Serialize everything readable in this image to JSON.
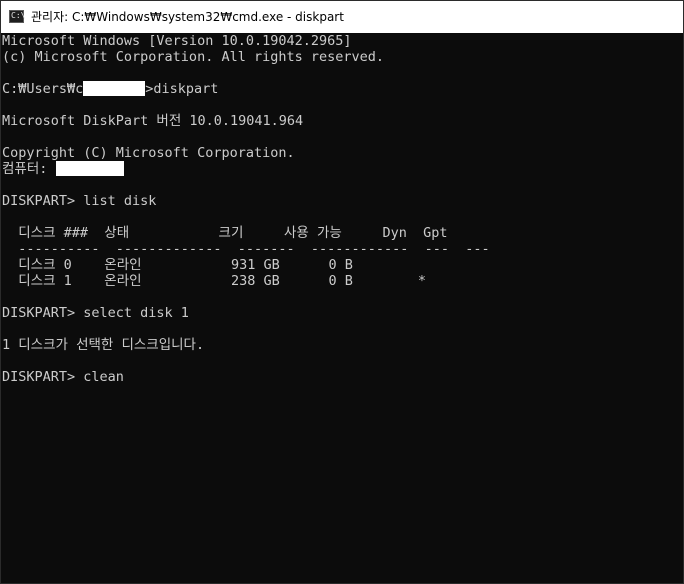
{
  "window": {
    "title": "관리자: C:₩Windows₩system32₩cmd.exe - diskpart",
    "icon": "cmd-icon",
    "icon_glyph": "C:\\"
  },
  "console": {
    "version_line": "Microsoft Windows [Version 10.0.19042.2965]",
    "copyright_line": "(c) Microsoft Corporation. All rights reserved.",
    "prompt_prefix": "C:₩Users₩c",
    "prompt_suffix": ">diskpart",
    "diskpart_version": "Microsoft DiskPart 버전 10.0.19041.964",
    "diskpart_copyright": "Copyright (C) Microsoft Corporation.",
    "computer_label": "컴퓨터: ",
    "cmd_list": "DISKPART> list disk",
    "table_header": "  디스크 ###  상태           크기     사용 가능     Dyn  Gpt",
    "table_divider": "  ----------  -------------  -------  ------------  ---  ---",
    "table_row_0": "  디스크 0    온라인           931 GB      0 B",
    "table_row_1": "  디스크 1    온라인           238 GB      0 B        *",
    "cmd_select": "DISKPART> select disk 1",
    "select_result": "1 디스크가 선택한 디스크입니다.",
    "cmd_clean": "DISKPART> clean"
  },
  "colors": {
    "console_bg": "#0c0c0c",
    "console_text": "#cccccc",
    "titlebar_bg": "#ffffff",
    "redaction": "#ffffff"
  }
}
